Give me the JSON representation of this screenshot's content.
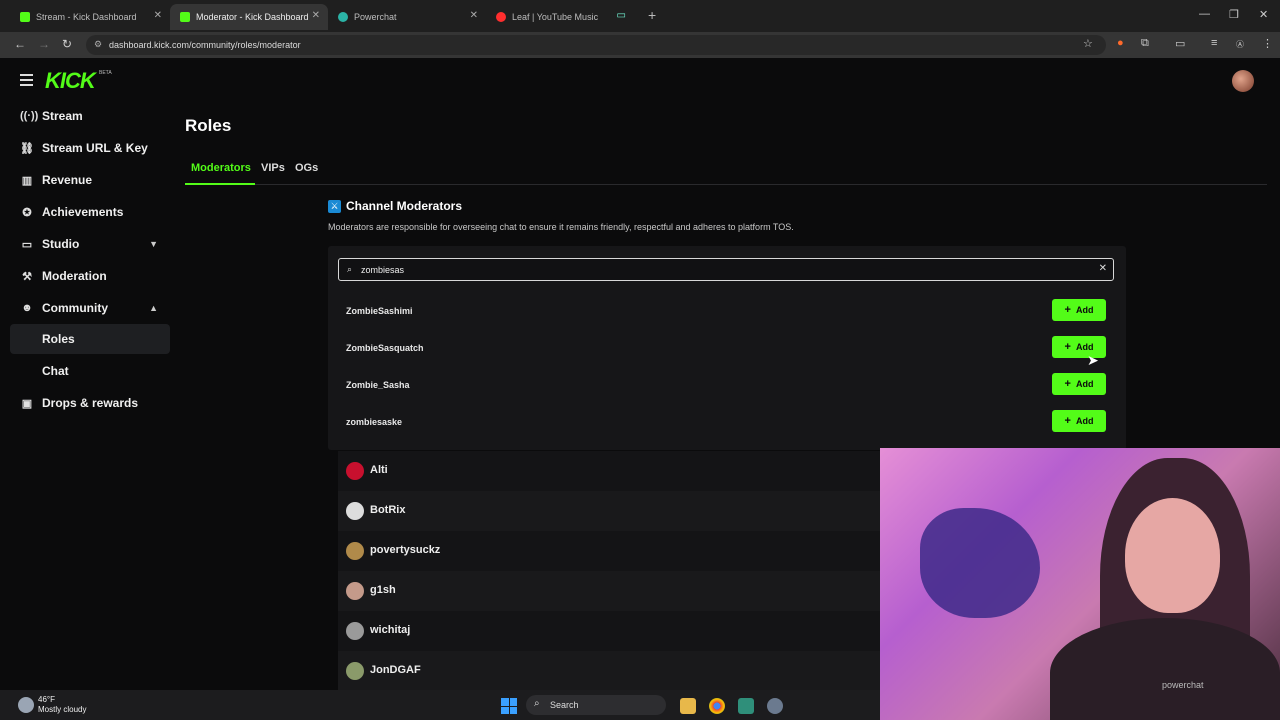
{
  "browser": {
    "tabs": [
      {
        "title": "Stream - Kick Dashboard",
        "fav_color": "#53fc18"
      },
      {
        "title": "Moderator - Kick Dashboard",
        "fav_color": "#53fc18"
      },
      {
        "title": "Powerchat",
        "fav_color": "#2bb3a6"
      },
      {
        "title": "Leaf | YouTube Music",
        "fav_color": "#ff2e2e"
      }
    ],
    "url": "dashboard.kick.com/community/roles/moderator"
  },
  "header": {
    "logo": "KICK",
    "beta": "BETA"
  },
  "sidebar": {
    "items": [
      {
        "label": "Stream",
        "icon": "broadcast-icon",
        "glyph": "((·))"
      },
      {
        "label": "Stream URL & Key",
        "icon": "link-icon",
        "glyph": "⛓"
      },
      {
        "label": "Revenue",
        "icon": "chart-icon",
        "glyph": "▥"
      },
      {
        "label": "Achievements",
        "icon": "trophy-icon",
        "glyph": "✪"
      },
      {
        "label": "Studio",
        "icon": "monitor-icon",
        "glyph": "▭"
      },
      {
        "label": "Moderation",
        "icon": "hammer-icon",
        "glyph": "⚒"
      },
      {
        "label": "Community",
        "icon": "people-icon",
        "glyph": "☻"
      },
      {
        "label": "Roles"
      },
      {
        "label": "Chat"
      },
      {
        "label": "Drops & rewards",
        "icon": "gift-icon",
        "glyph": "▣"
      }
    ]
  },
  "main": {
    "title": "Roles",
    "tabs": [
      "Moderators",
      "VIPs",
      "OGs"
    ],
    "section_title": "Channel Moderators",
    "section_desc": "Moderators are responsible for overseeing chat to ensure it remains friendly, respectful and adheres to platform TOS.",
    "search_value": "zombiesas",
    "results": [
      "ZombieSashimi",
      "ZombieSasquatch",
      "Zombie_Sasha",
      "zombiesaske"
    ],
    "add_label": "Add",
    "moderators": [
      {
        "name": "Alti",
        "color": "#c8102e"
      },
      {
        "name": "BotRix",
        "color": "#dddddd"
      },
      {
        "name": "povertysuckz",
        "color": "#b08a4a"
      },
      {
        "name": "g1sh",
        "color": "#c49a8a"
      },
      {
        "name": "wichitaj",
        "color": "#9a9a9a"
      },
      {
        "name": "JonDGAF",
        "color": "#8a9a6a"
      }
    ]
  },
  "webcam": {
    "shirt_text": "powerchat"
  },
  "taskbar": {
    "temp": "46°F",
    "weather": "Mostly cloudy",
    "search": "Search"
  },
  "colors": {
    "accent": "#53fc18",
    "background": "#0b0b0c"
  }
}
